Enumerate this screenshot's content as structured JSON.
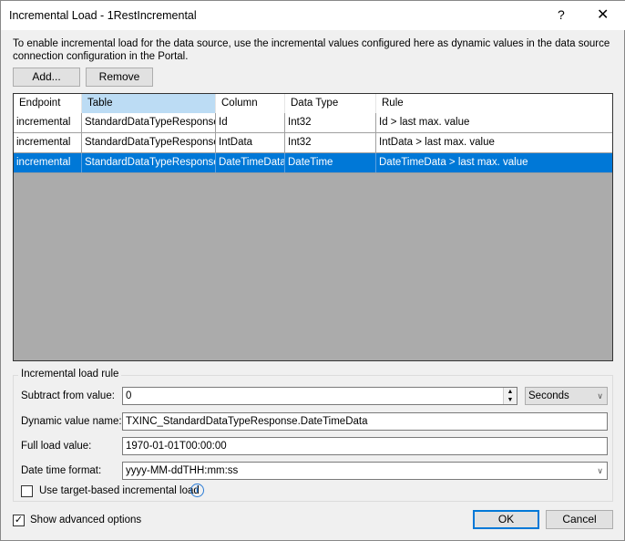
{
  "window": {
    "title": "Incremental Load - 1RestIncremental",
    "help": "?",
    "close": "✕"
  },
  "description": "To enable incremental load for the data source, use the incremental values configured here as dynamic values in the data source connection configuration in the Portal.",
  "toolbar": {
    "add": "Add...",
    "remove": "Remove"
  },
  "grid": {
    "columns": [
      "Endpoint",
      "Table",
      "Column",
      "Data Type",
      "Rule"
    ],
    "rows": [
      [
        "incremental",
        "StandardDataTypeResponse",
        "Id",
        "Int32",
        "Id > last max. value"
      ],
      [
        "incremental",
        "StandardDataTypeResponse",
        "IntData",
        "Int32",
        "IntData > last max. value"
      ],
      [
        "incremental",
        "StandardDataTypeResponse",
        "DateTimeData",
        "DateTime",
        "DateTimeData > last max. value"
      ]
    ],
    "selected_row": 2
  },
  "rule": {
    "group_label": "Incremental load rule",
    "subtract_label": "Subtract from value:",
    "subtract_value": "0",
    "unit": "Seconds",
    "dynamic_label": "Dynamic value name:",
    "dynamic_value": "TXINC_StandardDataTypeResponse.DateTimeData",
    "full_label": "Full load value:",
    "full_value": "1970-01-01T00:00:00",
    "format_label": "Date time format:",
    "format_value": "yyyy-MM-ddTHH:mm:ss",
    "target_based_label": "Use target-based incremental load",
    "target_based_checked": false
  },
  "footer": {
    "advanced_label": "Show advanced options",
    "advanced_checked": true,
    "ok": "OK",
    "cancel": "Cancel"
  },
  "colors": {
    "selection": "#0078d7",
    "grid_empty": "#ababab",
    "sorted_header": "#bcdcf4"
  }
}
